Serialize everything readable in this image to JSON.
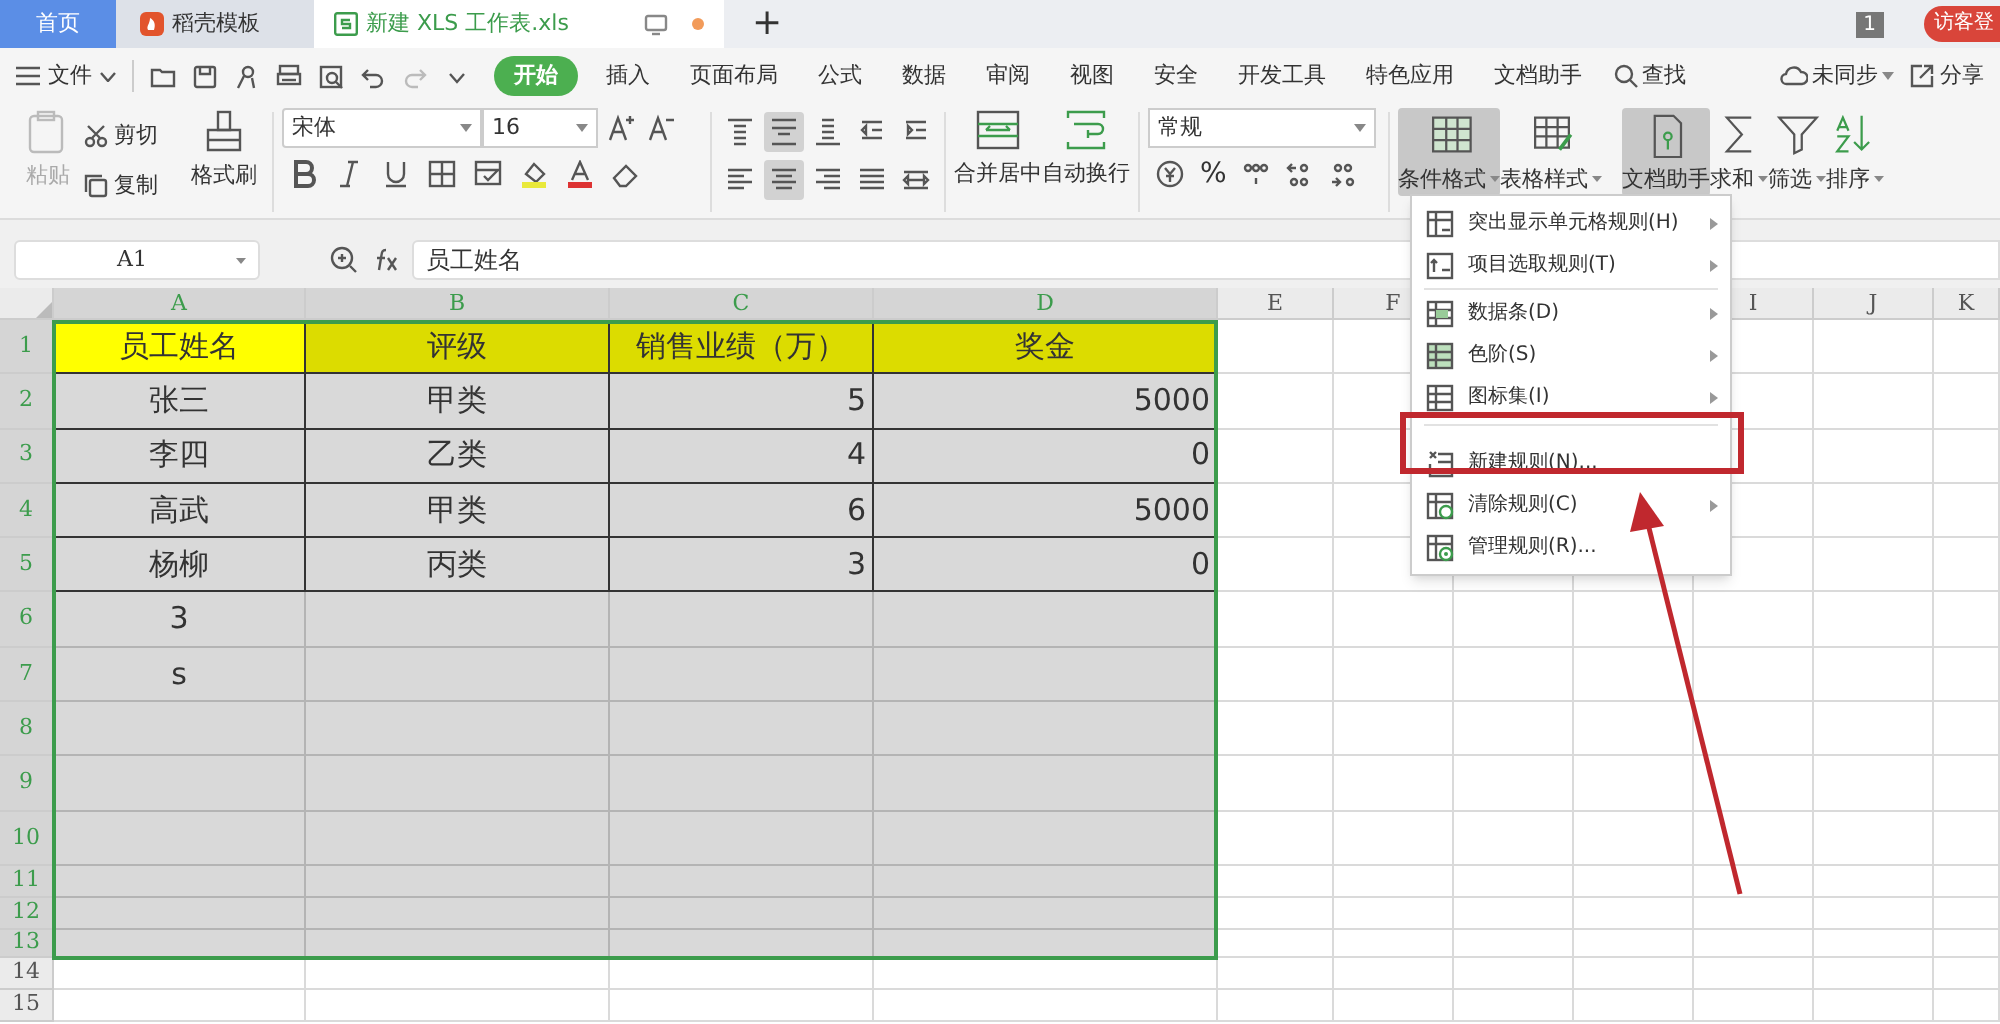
{
  "tabs": [
    {
      "kind": "home",
      "label": "首页",
      "selected": false
    },
    {
      "kind": "template",
      "label": "稻壳模板",
      "selected": false
    },
    {
      "kind": "sheet",
      "label": "新建 XLS 工作表.xls",
      "selected": true
    }
  ],
  "new_tab": "+",
  "window_count": "1",
  "login": "访客登",
  "menu": {
    "file": "文件",
    "tabs": [
      {
        "label": "开始",
        "selected": true
      },
      {
        "label": "插入",
        "selected": false
      },
      {
        "label": "页面布局",
        "selected": false
      },
      {
        "label": "公式",
        "selected": false
      },
      {
        "label": "数据",
        "selected": false
      },
      {
        "label": "审阅",
        "selected": false
      },
      {
        "label": "视图",
        "selected": false
      },
      {
        "label": "安全",
        "selected": false
      },
      {
        "label": "开发工具",
        "selected": false
      },
      {
        "label": "特色应用",
        "selected": false
      },
      {
        "label": "文档助手",
        "selected": false
      }
    ],
    "search": "查找",
    "sync": "未同步",
    "share": "分享"
  },
  "ribbon": {
    "paste": "粘贴",
    "cut": "剪切",
    "copy": "复制",
    "format_painter": "格式刷",
    "font": "宋体",
    "font_size": "16",
    "merge": "合并居中",
    "wrap": "自动换行",
    "number_format": "常规",
    "percent": "%",
    "align_top": [
      {
        "kind": "top",
        "active": false
      },
      {
        "kind": "middle",
        "active": true
      },
      {
        "kind": "bottom",
        "active": false
      },
      {
        "kind": "outdent",
        "active": false
      },
      {
        "kind": "indent",
        "active": false
      }
    ],
    "align_bottom": [
      {
        "kind": "left",
        "active": false
      },
      {
        "kind": "center",
        "active": true
      },
      {
        "kind": "right",
        "active": false
      },
      {
        "kind": "justify",
        "active": false
      },
      {
        "kind": "distributed",
        "active": false
      }
    ],
    "large_buttons": [
      {
        "kind": "conditional",
        "label": "条件格式",
        "active": true,
        "dropdown": true
      },
      {
        "kind": "table_style",
        "label": "表格样式",
        "active": false,
        "dropdown": true
      },
      {
        "kind": "assistant",
        "label": "文档助手",
        "active": true,
        "dropdown": false
      },
      {
        "kind": "sum",
        "label": "求和",
        "active": false,
        "dropdown": true
      },
      {
        "kind": "filter",
        "label": "筛选",
        "active": false,
        "dropdown": true
      },
      {
        "kind": "sort",
        "label": "排序",
        "active": false,
        "dropdown": true
      }
    ]
  },
  "formula_bar": {
    "name_box": "A1",
    "formula": "员工姓名"
  },
  "sheet": {
    "columns": [
      {
        "label": "A",
        "selected": true
      },
      {
        "label": "B",
        "selected": true
      },
      {
        "label": "C",
        "selected": true
      },
      {
        "label": "D",
        "selected": true
      },
      {
        "label": "E",
        "selected": false
      },
      {
        "label": "F",
        "selected": false
      },
      {
        "label": "I",
        "selected": false
      },
      {
        "label": "J",
        "selected": false
      },
      {
        "label": "K",
        "selected": false
      }
    ],
    "rows": [
      {
        "number": "1",
        "kind": "header",
        "selected": true,
        "cells": [
          {
            "text": "员工姓名",
            "active": true
          },
          {
            "text": "评级",
            "active": false
          },
          {
            "text": "销售业绩（万）",
            "active": false
          },
          {
            "text": "奖金",
            "active": false
          }
        ]
      },
      {
        "number": "2",
        "kind": "data",
        "selected": true,
        "cells": [
          {
            "text": "张三",
            "active": false
          },
          {
            "text": "甲类",
            "active": false
          },
          {
            "text": "5",
            "active": false
          },
          {
            "text": "5000",
            "active": false
          }
        ]
      },
      {
        "number": "3",
        "kind": "data",
        "selected": true,
        "cells": [
          {
            "text": "李四",
            "active": false
          },
          {
            "text": "乙类",
            "active": false
          },
          {
            "text": "4",
            "active": false
          },
          {
            "text": "0",
            "active": false
          }
        ]
      },
      {
        "number": "4",
        "kind": "data",
        "selected": true,
        "cells": [
          {
            "text": "高武",
            "active": false
          },
          {
            "text": "甲类",
            "active": false
          },
          {
            "text": "6",
            "active": false
          },
          {
            "text": "5000",
            "active": false
          }
        ]
      },
      {
        "number": "5",
        "kind": "data",
        "selected": true,
        "cells": [
          {
            "text": "杨柳",
            "active": false
          },
          {
            "text": "丙类",
            "active": false
          },
          {
            "text": "3",
            "active": false
          },
          {
            "text": "0",
            "active": false
          }
        ]
      },
      {
        "number": "6",
        "kind": "blank",
        "selected": true,
        "cells": [
          {
            "text": "3",
            "active": false
          }
        ]
      },
      {
        "number": "7",
        "kind": "blank",
        "selected": true,
        "cells": [
          {
            "text": "s",
            "active": false
          }
        ]
      },
      {
        "number": "8",
        "kind": "blank",
        "selected": true
      },
      {
        "number": "9",
        "kind": "blank",
        "selected": true
      },
      {
        "number": "10",
        "kind": "blank",
        "selected": true
      },
      {
        "number": "11",
        "kind": "blank",
        "selected": true
      },
      {
        "number": "12",
        "kind": "blank",
        "selected": true
      },
      {
        "number": "13",
        "kind": "blank",
        "selected": true
      },
      {
        "number": "14",
        "kind": "blank",
        "selected": false
      },
      {
        "number": "15",
        "kind": "blank",
        "selected": false
      }
    ]
  },
  "dropdown_menu": {
    "items": [
      {
        "kind": "highlight",
        "label": "突出显示单元格规则(H)",
        "submenu": true,
        "separator_after": false,
        "highlighted": false
      },
      {
        "kind": "top",
        "label": "项目选取规则(T)",
        "submenu": true,
        "separator_after": true,
        "highlighted": false
      },
      {
        "kind": "databar",
        "label": "数据条(D)",
        "submenu": true,
        "separator_after": false,
        "highlighted": false
      },
      {
        "kind": "colorscale",
        "label": "色阶(S)",
        "submenu": true,
        "separator_after": false,
        "highlighted": false
      },
      {
        "kind": "iconset",
        "label": "图标集(I)",
        "submenu": true,
        "separator_after": true,
        "highlighted": false
      },
      {
        "kind": "new",
        "label": "新建规则(N)...",
        "submenu": false,
        "separator_after": false,
        "highlighted": true
      },
      {
        "kind": "clear",
        "label": "清除规则(C)",
        "submenu": true,
        "separator_after": false,
        "highlighted": false
      },
      {
        "kind": "manage",
        "label": "管理规则(R)...",
        "submenu": false,
        "separator_after": false,
        "highlighted": false
      }
    ]
  }
}
